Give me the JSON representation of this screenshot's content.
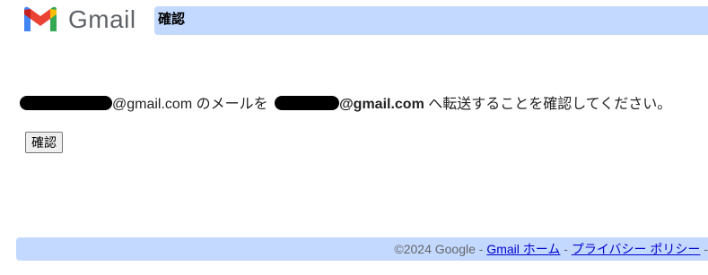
{
  "header": {
    "logo_text": "Gmail",
    "logo_icon": "gmail-m-logo-icon",
    "title": "確認"
  },
  "message": {
    "address_suffix": "@gmail.com",
    "text_middle": " のメールを ",
    "target_suffix": "@gmail.com",
    "text_end": " へ転送することを確認してください。"
  },
  "confirm_button": {
    "label": "確認"
  },
  "footer": {
    "copyright": "©2024 Google - ",
    "gmail_home_link": "Gmail ホーム",
    "separator": " - ",
    "privacy_link": "プライバシー ポリシー",
    "trailing": " -"
  },
  "colors": {
    "header_bar": "#c3d9ff",
    "footer_bar": "#c3d9ff",
    "link": "#0000cc"
  }
}
